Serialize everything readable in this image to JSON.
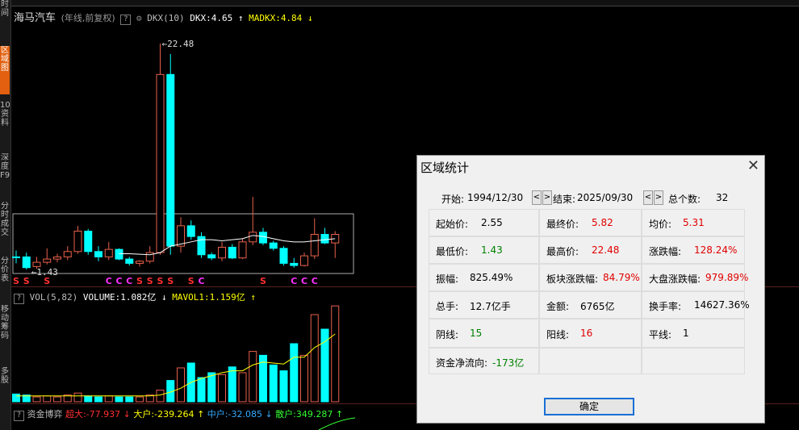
{
  "colors": {
    "up": "#e8604c",
    "down": "#00ffff",
    "ma": "#ffffff",
    "vol_ma": "#ffff00",
    "dkx": "#ffffff",
    "madkx": "#ffff00"
  },
  "left_tabs": [
    "时间",
    "区域图",
    "10资料",
    "深度F9",
    "分时成交",
    "分价表",
    "移动筹码",
    "多股"
  ],
  "header": {
    "stock": "海马汽车",
    "period": "(年线,前复权)",
    "q": "?",
    "indicator": "DKX(10)",
    "dkx": "DKX:4.65",
    "dkx_arrow": "↑",
    "madkx": "MADKX:4.84",
    "madkx_arrow": "↓"
  },
  "price_labels": {
    "high": "22.48",
    "low": "1.43",
    "high_arrow": "←",
    "low_arrow": "←"
  },
  "vol_header": {
    "name": "VOL(5,82)",
    "volume": "VOLUME:1.082亿",
    "arrow1": "↓",
    "mavol": "MAVOL1:1.159亿",
    "arrow2": "↑"
  },
  "bottom_header": {
    "name": "资金博弈",
    "super": "超大:-77.937",
    "a1": "↓",
    "big": "大户:-239.264",
    "a2": "↑",
    "mid": "中户:-32.085",
    "a3": "↓",
    "retail": "散户:349.287",
    "a4": "↑"
  },
  "markers": [
    {
      "text": "S",
      "color": "#ff3030"
    },
    {
      "text": "S",
      "color": "#ff3030"
    },
    {
      "text": "S",
      "color": "#ff3030"
    },
    {
      "text": "C",
      "color": "#ff30ff"
    },
    {
      "text": "C",
      "color": "#ff30ff"
    },
    {
      "text": "C",
      "color": "#ff30ff"
    },
    {
      "text": "S",
      "color": "#ff3030"
    },
    {
      "text": "S",
      "color": "#ff3030"
    },
    {
      "text": "S",
      "color": "#ff3030"
    },
    {
      "text": "S",
      "color": "#ff3030"
    },
    {
      "text": "S",
      "color": "#ff3030"
    },
    {
      "text": "C",
      "color": "#ff30ff"
    },
    {
      "text": "S",
      "color": "#ff3030"
    },
    {
      "text": "C",
      "color": "#ff30ff"
    },
    {
      "text": "C",
      "color": "#ff30ff"
    },
    {
      "text": "C",
      "color": "#ff30ff"
    }
  ],
  "chart_data": {
    "type": "candlestick",
    "candles": [
      {
        "o": 2.6,
        "h": 3.2,
        "l": 2.0,
        "c": 2.55
      },
      {
        "o": 2.6,
        "h": 3.0,
        "l": 1.43,
        "c": 1.6
      },
      {
        "o": 1.7,
        "h": 2.6,
        "l": 1.5,
        "c": 2.1
      },
      {
        "o": 2.1,
        "h": 3.4,
        "l": 1.9,
        "c": 2.4
      },
      {
        "o": 2.4,
        "h": 2.9,
        "l": 2.1,
        "c": 2.6
      },
      {
        "o": 2.6,
        "h": 3.6,
        "l": 2.3,
        "c": 3.1
      },
      {
        "o": 3.1,
        "h": 5.5,
        "l": 2.9,
        "c": 5.0
      },
      {
        "o": 5.0,
        "h": 5.2,
        "l": 2.8,
        "c": 3.1
      },
      {
        "o": 3.1,
        "h": 3.6,
        "l": 2.2,
        "c": 2.6
      },
      {
        "o": 2.6,
        "h": 4.0,
        "l": 2.3,
        "c": 3.3
      },
      {
        "o": 3.3,
        "h": 3.4,
        "l": 2.3,
        "c": 2.4
      },
      {
        "o": 2.4,
        "h": 2.6,
        "l": 1.8,
        "c": 2.0
      },
      {
        "o": 2.0,
        "h": 2.3,
        "l": 1.7,
        "c": 2.2
      },
      {
        "o": 2.2,
        "h": 3.6,
        "l": 2.0,
        "c": 3.0
      },
      {
        "o": 3.0,
        "h": 22.48,
        "l": 2.8,
        "c": 19.6
      },
      {
        "o": 19.6,
        "h": 21.5,
        "l": 2.8,
        "c": 3.6
      },
      {
        "o": 3.6,
        "h": 6.3,
        "l": 3.0,
        "c": 5.5
      },
      {
        "o": 5.5,
        "h": 6.0,
        "l": 4.2,
        "c": 4.5
      },
      {
        "o": 4.5,
        "h": 4.9,
        "l": 2.5,
        "c": 2.8
      },
      {
        "o": 2.8,
        "h": 3.0,
        "l": 2.3,
        "c": 2.5
      },
      {
        "o": 2.5,
        "h": 4.0,
        "l": 2.2,
        "c": 3.5
      },
      {
        "o": 3.5,
        "h": 3.8,
        "l": 2.4,
        "c": 2.5
      },
      {
        "o": 2.5,
        "h": 4.3,
        "l": 2.4,
        "c": 4.0
      },
      {
        "o": 4.0,
        "h": 8.2,
        "l": 3.7,
        "c": 4.9
      },
      {
        "o": 4.9,
        "h": 5.3,
        "l": 3.7,
        "c": 3.9
      },
      {
        "o": 3.9,
        "h": 4.1,
        "l": 3.2,
        "c": 3.4
      },
      {
        "o": 3.4,
        "h": 3.6,
        "l": 1.8,
        "c": 2.0
      },
      {
        "o": 2.0,
        "h": 2.5,
        "l": 1.6,
        "c": 1.8
      },
      {
        "o": 1.8,
        "h": 3.0,
        "l": 1.7,
        "c": 2.7
      },
      {
        "o": 2.7,
        "h": 6.2,
        "l": 2.4,
        "c": 4.7
      },
      {
        "o": 4.7,
        "h": 5.3,
        "l": 3.8,
        "c": 3.9
      },
      {
        "o": 3.9,
        "h": 5.0,
        "l": 2.5,
        "c": 4.7
      }
    ],
    "volume": [
      0.08,
      0.07,
      0.05,
      0.06,
      0.05,
      0.07,
      0.09,
      0.06,
      0.05,
      0.06,
      0.05,
      0.05,
      0.05,
      0.07,
      0.12,
      0.22,
      0.35,
      0.4,
      0.25,
      0.3,
      0.28,
      0.36,
      0.3,
      0.52,
      0.48,
      0.38,
      0.32,
      0.6,
      0.48,
      0.9,
      0.75,
      0.99
    ],
    "dkx_line": [
      null,
      null,
      null,
      null,
      null,
      null,
      null,
      null,
      null,
      null,
      2.9,
      2.9,
      2.85,
      2.8,
      3.0,
      3.6,
      3.8,
      4.0,
      4.2,
      4.2,
      4.1,
      4.2,
      4.3,
      4.6,
      4.5,
      4.3,
      4.1,
      4.0,
      4.0,
      4.1,
      4.2,
      4.3
    ],
    "vol_ma": [
      0.06,
      0.06,
      0.06,
      0.06,
      0.06,
      0.06,
      0.06,
      0.06,
      0.06,
      0.06,
      0.06,
      0.06,
      0.06,
      0.06,
      0.07,
      0.1,
      0.14,
      0.2,
      0.24,
      0.27,
      0.3,
      0.32,
      0.32,
      0.38,
      0.41,
      0.4,
      0.39,
      0.46,
      0.46,
      0.56,
      0.62,
      0.7
    ]
  },
  "dialog": {
    "title": "区域统计",
    "close": "✕",
    "start_label": "开始:",
    "start": "1994/12/30",
    "end_label": "结束:",
    "end": "2025/09/30",
    "nav_prev": "<",
    "nav_next": ">",
    "count_label": "总个数:",
    "count": "32",
    "cells": [
      {
        "label": "起始价:",
        "value": "2.55",
        "cls": ""
      },
      {
        "label": "最终价:",
        "value": "5.82",
        "cls": "red"
      },
      {
        "label": "均价:",
        "value": "5.31",
        "cls": "red"
      },
      {
        "label": "最低价:",
        "value": "1.43",
        "cls": "green"
      },
      {
        "label": "最高价:",
        "value": "22.48",
        "cls": "red"
      },
      {
        "label": "涨跌幅:",
        "value": "128.24%",
        "cls": "red"
      },
      {
        "label": "振幅:",
        "value": "825.49%",
        "cls": ""
      },
      {
        "label": "板块涨跌幅:",
        "value": "84.79%",
        "cls": "red"
      },
      {
        "label": "大盘涨跌幅:",
        "value": "979.89%",
        "cls": "red"
      },
      {
        "label": "总手:",
        "value": "12.7亿手",
        "cls": ""
      },
      {
        "label": "金额:",
        "value": "6765亿",
        "cls": ""
      },
      {
        "label": "换手率:",
        "value": "14627.36%",
        "cls": ""
      },
      {
        "label": "阴线:",
        "value": "15",
        "cls": "green"
      },
      {
        "label": "阳线:",
        "value": "16",
        "cls": "red"
      },
      {
        "label": "平线:",
        "value": "1",
        "cls": ""
      },
      {
        "label": "资金净流向:",
        "value": "-173亿",
        "cls": "green"
      },
      {
        "label": "",
        "value": "",
        "cls": ""
      },
      {
        "label": "",
        "value": "",
        "cls": ""
      }
    ],
    "ok": "确定"
  }
}
